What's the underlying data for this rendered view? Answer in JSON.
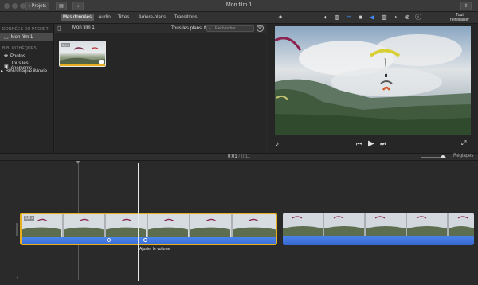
{
  "window": {
    "title": "Mon film 1",
    "back_label": "Projets"
  },
  "toolbar": {
    "tabs": [
      {
        "label": "Mes données",
        "active": true
      },
      {
        "label": "Audio",
        "active": false
      },
      {
        "label": "Titres",
        "active": false
      },
      {
        "label": "Arrière-plans",
        "active": false
      },
      {
        "label": "Transitions",
        "active": false
      }
    ],
    "reset_all_label": "Tout réinitialiser",
    "icons": [
      "magic-wand",
      "color-balance",
      "color-correction",
      "crop",
      "stabilization",
      "volume",
      "noise-reduction",
      "speed",
      "clip-filter",
      "info"
    ]
  },
  "sidebar": {
    "section_project": "DONNÉES DU PROJET",
    "project_item": "Mon film 1",
    "section_libraries": "BIBLIOTHÈQUES",
    "items": [
      "Photos",
      "Tous les…énements",
      "Bibliothèque iMovie"
    ]
  },
  "browser": {
    "title": "Mon film 1",
    "filter": "Tous les plans",
    "search_placeholder": "Rechercher",
    "thumb_duration": "5,8 s"
  },
  "viewer": {
    "controls": [
      "microphone",
      "skip-back",
      "play",
      "skip-forward",
      "fullscreen"
    ]
  },
  "timeline": {
    "timecode_current": "0:01",
    "timecode_sep": "/",
    "timecode_total": "0:11",
    "settings_label": "Réglages",
    "clip1_label": "5,8 s",
    "tooltip": "Ajuster le volume"
  },
  "colors": {
    "accent_blue": "#3d8ff5",
    "selection_yellow": "#e8b021",
    "audio_blue": "#3e6fd6"
  }
}
